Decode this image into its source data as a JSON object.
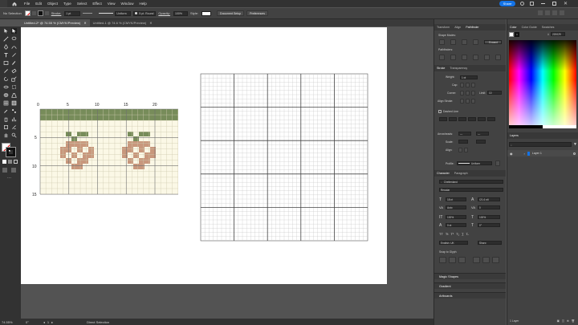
{
  "menubar": {
    "items": [
      "File",
      "Edit",
      "Object",
      "Type",
      "Select",
      "Effect",
      "View",
      "Window",
      "Help"
    ],
    "share_label": "Share"
  },
  "control_bar": {
    "selection": "No Selection",
    "stroke_label": "Stroke:",
    "stroke_weight": "1 pt",
    "uniform": "Uniform",
    "brush": "5 pt. Round",
    "opacity_label": "Opacity:",
    "opacity_value": "100%",
    "style_label": "Style:",
    "doc_setup": "Document Setup",
    "preferences": "Preferences"
  },
  "tabs": [
    {
      "label": "Untitled-2* @ 74.55 % (CMYK/Preview)"
    },
    {
      "label": "Untitled-1 @ 74.6 % (CMYK/Preview)"
    }
  ],
  "ruler_labels": {
    "top": [
      "0",
      "5",
      "10",
      "15",
      "20"
    ],
    "left": [
      "5",
      "10",
      "15"
    ]
  },
  "status": {
    "zoom": "74.55%",
    "rotate": "0°",
    "artboard": "1",
    "tool": "Direct Selection"
  },
  "pathfinder": {
    "tabs": [
      "Transform",
      "Align",
      "Pathfinder"
    ],
    "shape_modes": "Shape Modes:",
    "pathfinders": "Pathfinders:",
    "expand": "Expand"
  },
  "stroke_panel": {
    "tabs": [
      "Stroke",
      "Transparency"
    ],
    "weight_label": "Weight:",
    "weight_value": "1 pt",
    "cap_label": "Cap:",
    "corner_label": "Corner:",
    "limit_label": "Limit:",
    "limit_value": "10",
    "align_label": "Align Stroke:",
    "dashed": "Dashed Line",
    "arrowheads": "Arrowheads:",
    "scale": "Scale:",
    "align": "Align:",
    "profile": "Profile:",
    "profile_value": "Uniform"
  },
  "character": {
    "tabs": [
      "Character",
      "Paragraph"
    ],
    "font": "Cheltenland",
    "style": "Regular",
    "size": "18 pt",
    "leading": "(21.6 pt)",
    "kerning": "Auto",
    "tracking": "0",
    "vscale": "100%",
    "hscale": "100%",
    "baseline": "0 pt",
    "rotation": "0°",
    "language": "English: UK",
    "aa": "Sharp",
    "snap": "Snap to Glyph"
  },
  "collapsed": [
    "Magic Shapes",
    "Gradient",
    "Artboards"
  ],
  "color_panel": {
    "tabs": [
      "Color",
      "Color Guide",
      "Swatches"
    ],
    "hex": "220029"
  },
  "layers": {
    "tab": "Layers",
    "layer_name": "Layer 1",
    "count": "1 Layer"
  },
  "colors": {
    "leaf": "#778c5a",
    "berry": "#c8977c",
    "grid_bg": "#fbf8e6",
    "accent": "#1473e6"
  }
}
